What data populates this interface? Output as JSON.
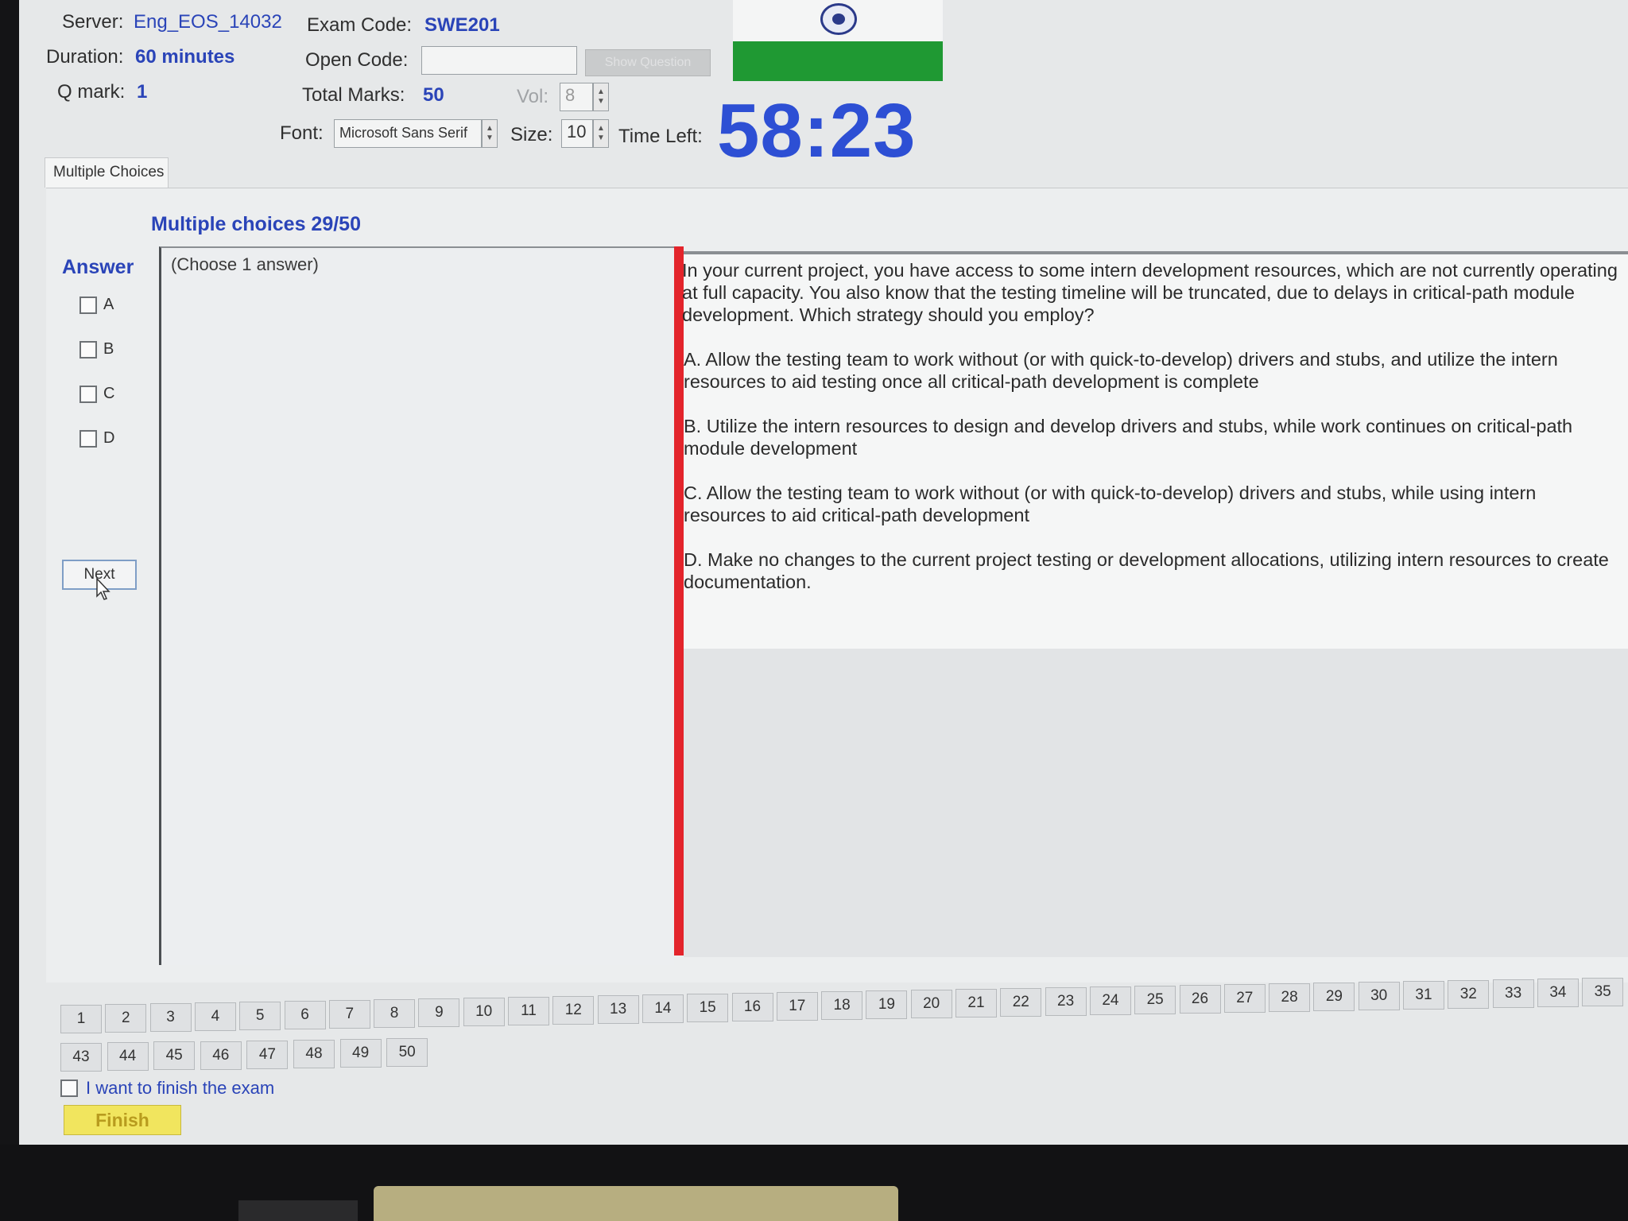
{
  "header": {
    "server_label": "Server:",
    "server_value": "Eng_EOS_14032",
    "exam_code_label": "Exam Code:",
    "exam_code_value": "SWE201",
    "duration_label": "Duration:",
    "duration_value": "60 minutes",
    "open_code_label": "Open Code:",
    "open_code_value": "",
    "show_question_label": "Show Question",
    "q_mark_label": "Q mark:",
    "q_mark_value": "1",
    "total_marks_label": "Total Marks:",
    "total_marks_value": "50",
    "vol_label": "Vol:",
    "vol_value": "8",
    "font_label": "Font:",
    "font_value": "Microsoft Sans Serif",
    "size_label": "Size:",
    "size_value": "10",
    "time_left_label": "Time Left:",
    "time_left_value": "58:23"
  },
  "tab": {
    "label": "Multiple Choices"
  },
  "question": {
    "section_title": "Multiple choices 29/50",
    "answer_title": "Answer",
    "choose_hint": "(Choose 1 answer)",
    "text": "In your current project, you have access to some intern development resources, which are not currently operating at full capacity. You also know that the testing timeline will be truncated, due to delays in critical-path module development. Which strategy should you employ?",
    "choices": [
      "A.  Allow the testing team to work without (or with quick-to-develop) drivers and stubs, and utilize the intern resources to aid testing once all critical-path development is complete",
      "B.  Utilize the intern resources to design and develop drivers and stubs, while work continues on critical-path module development",
      "C.  Allow the testing team to work without (or with quick-to-develop) drivers and stubs, while using intern resources to aid critical-path development",
      "D.  Make no changes to the current project testing or development allocations, utilizing intern resources to create documentation."
    ],
    "answer_options": [
      "A",
      "B",
      "C",
      "D"
    ],
    "next_label": "Next"
  },
  "navigation": {
    "row1": [
      "1",
      "2",
      "3",
      "4",
      "5",
      "6",
      "7",
      "8",
      "9",
      "10",
      "11",
      "12",
      "13",
      "14",
      "15",
      "16",
      "17",
      "18",
      "19",
      "20",
      "21",
      "22",
      "23",
      "24",
      "25",
      "26",
      "27",
      "28",
      "29",
      "30",
      "31",
      "32",
      "33",
      "34",
      "35"
    ],
    "row2": [
      "43",
      "44",
      "45",
      "46",
      "47",
      "48",
      "49",
      "50"
    ]
  },
  "footer": {
    "finish_check_label": "I want to finish the exam",
    "finish_label": "Finish"
  },
  "colors": {
    "accent_blue": "#2a44b8",
    "timer_blue": "#2d4fd4",
    "divider_red": "#e3242b",
    "flag_green": "#1f9933",
    "finish_yellow": "#f1e55e"
  }
}
